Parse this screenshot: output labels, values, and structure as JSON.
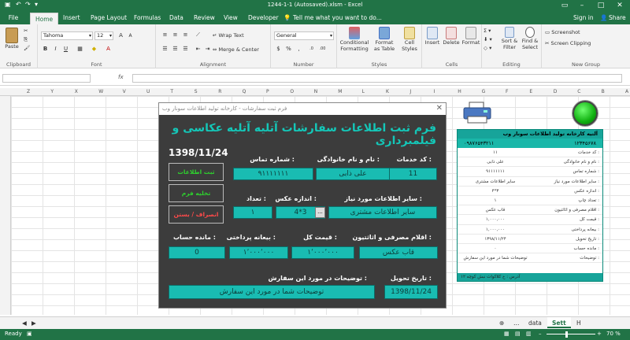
{
  "window": {
    "title": "1244-1-1 (Autosaved).xlsm - Excel",
    "signin": "Sign in",
    "share": "Share"
  },
  "ribbon_tabs": [
    "File",
    "Home",
    "Insert",
    "Page Layout",
    "Formulas",
    "Data",
    "Review",
    "View",
    "Developer"
  ],
  "tell_me": "Tell me what you want to do...",
  "ribbon": {
    "clipboard": {
      "paste": "Paste",
      "label": "Clipboard"
    },
    "font": {
      "name": "Tahoma",
      "size": "12",
      "label": "Font"
    },
    "alignment": {
      "wrap": "Wrap Text",
      "merge": "Merge & Center",
      "label": "Alignment"
    },
    "number": {
      "format": "General",
      "label": "Number"
    },
    "styles": {
      "conditional": "Conditional Formatting",
      "format_table": "Format as Table",
      "cell_styles": "Cell Styles",
      "label": "Styles"
    },
    "cells": {
      "insert": "Insert",
      "delete": "Delete",
      "format": "Format",
      "label": "Cells"
    },
    "editing": {
      "sort": "Sort & Filter",
      "find": "Find & Select",
      "label": "Editing"
    },
    "new_group": {
      "screenshot": "Screenshot",
      "clipping": "Screen Clipping",
      "label": "New Group"
    }
  },
  "formula": {
    "fx": "fx"
  },
  "columns": [
    "Z",
    "Y",
    "X",
    "W",
    "V",
    "U",
    "T",
    "S",
    "R",
    "Q",
    "P",
    "O",
    "N",
    "M",
    "L",
    "K",
    "J",
    "I",
    "H",
    "G",
    "F",
    "E",
    "D",
    "C",
    "B",
    "A"
  ],
  "sheets": {
    "data": "data",
    "sett": "Sett",
    "h": "H"
  },
  "status": {
    "ready": "Ready",
    "zoom": "70 %"
  },
  "panel": {
    "header": "آلتیه کارخانه تولید اطلاعات سونار وب",
    "phone1": "۰۹۸۷۶۵۴۳۲۱۱",
    "phone2": "۱۲۳۴۵۶۷۸",
    "rows": [
      {
        "label": "کد خدمات :",
        "value": "۱۱"
      },
      {
        "label": "نام و نام خانوادگی :",
        "value": "علی ذابی"
      },
      {
        "label": "شماره تماس :",
        "value": "۹۱۱۱۱۱۱۱"
      },
      {
        "label": "سایر اطلاعات مورد نیاز :",
        "value": "سایر اطلاعات مشتری"
      },
      {
        "label": "اندازه عکس :",
        "value": "۴*۳"
      },
      {
        "label": "تعداد چاپ :",
        "value": "۱"
      },
      {
        "label": "اقلام مصرفی و اثاثتیون :",
        "value": "قاب عکس"
      },
      {
        "label": "قیمت کل :",
        "value": "۱,۰۰۰,۰۰۰"
      },
      {
        "label": "بیعانه پرداختی :",
        "value": "۱,۰۰۰,۰۰۰"
      },
      {
        "label": "تاریخ تحویل :",
        "value": "۱۳۹۸/۱۱/۲۴"
      },
      {
        "label": "مانده حساب :",
        "value": "۰"
      },
      {
        "label": "توضیحات :",
        "value": "توضیحات شما در مورد این سفارش"
      }
    ],
    "footer": "آدرس : خ کلاکوات نبش کوچه ۱۲"
  },
  "dialog": {
    "title": "فرم ثبت سفارشات - کارخانه تولید اطلاعات سونار وب",
    "heading": "فرم ثبت اطلاعات سفارشات آتلیه آتلیه عکاسی و فیلمبرداری",
    "date": "1398/11/24",
    "btn_save": "ثبت اطلاعات",
    "btn_clear": "تخلیه فرم",
    "btn_cancel": "انصراف / بستن",
    "lbl_code": "کد خدمات :",
    "lbl_name": "نام و نام خانوادگی :",
    "lbl_phone": "شماره تماس :",
    "val_code": "11",
    "val_name": "علی ذابی",
    "val_phone": "۹۱۱۱۱۱۱۱",
    "lbl_other": "سایر اطلاعات مورد نیاز :",
    "lbl_size": "اندازه عکس :",
    "lbl_count": "تعداد :",
    "val_other": "سایر اطلاعات مشتری",
    "val_size": "4*3",
    "val_count": "۱",
    "lbl_items": "اقلام مصرفی و اثاثتیون :",
    "lbl_total": "قیمت کل :",
    "lbl_deposit": "بیعانه پرداختی :",
    "lbl_remain": "مانده حساب :",
    "val_items": "قاب عکس",
    "val_total": "۱٬۰۰۰٬۰۰۰",
    "val_deposit": "۱٬۰۰۰٬۰۰۰",
    "val_remain": "0",
    "lbl_desc": "توضیحات در مورد این سفارش :",
    "lbl_delivery": "تاریخ تحویل :",
    "val_desc": "توضیحات شما در مورد این سفارش",
    "val_delivery": "1398/11/24",
    "dots": "..."
  }
}
